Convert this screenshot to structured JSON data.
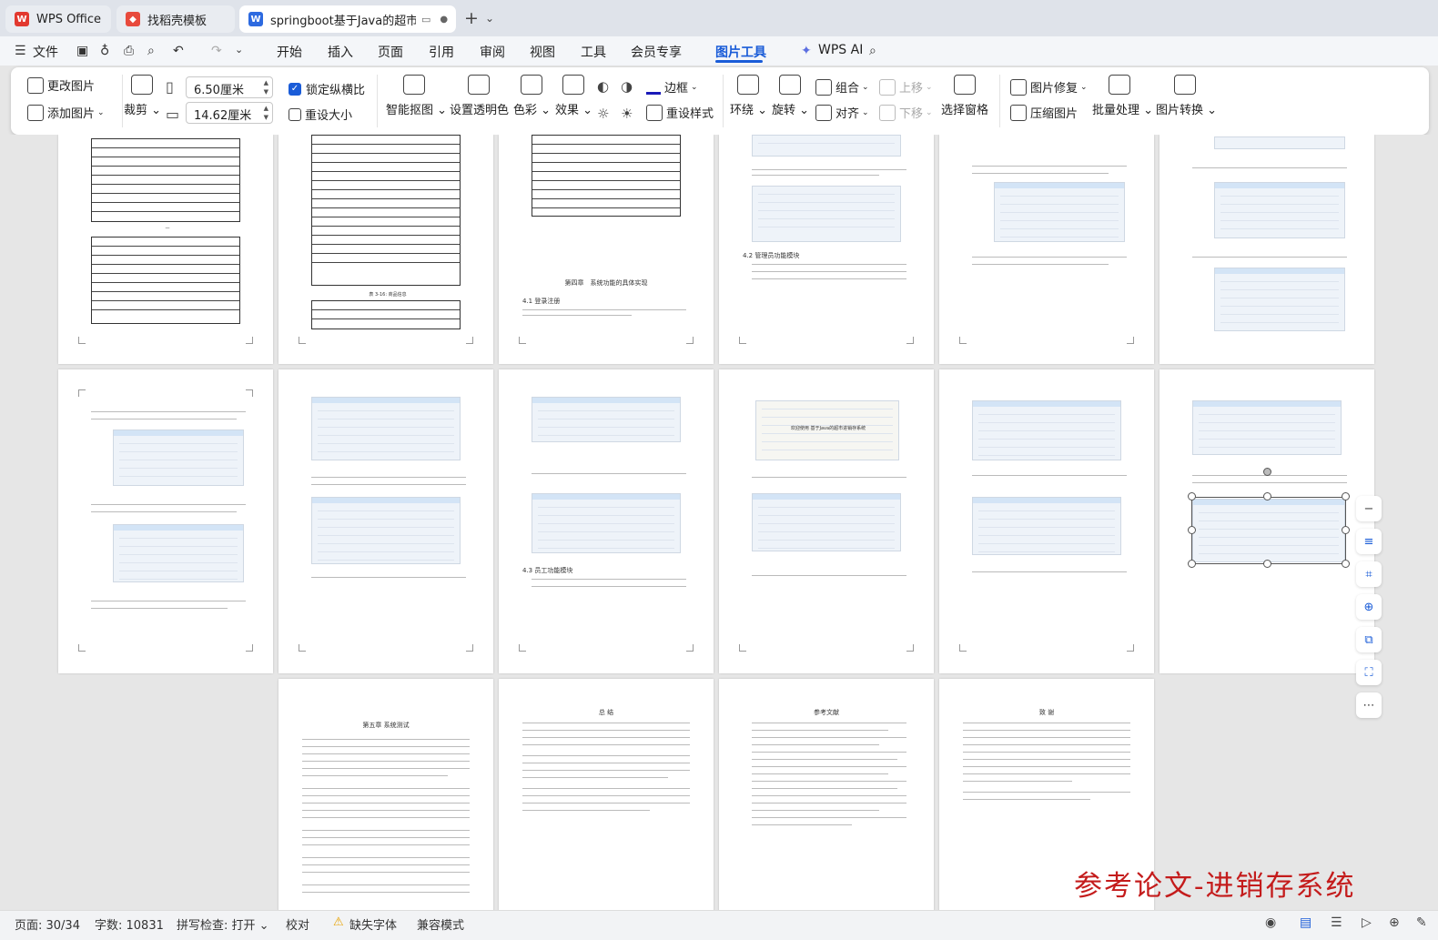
{
  "tabs": {
    "t1": "WPS Office",
    "t2": "找稻壳模板",
    "t3": "springboot基于Java的超市进"
  },
  "menu": {
    "file": "文件",
    "items": [
      "开始",
      "插入",
      "页面",
      "引用",
      "审阅",
      "视图",
      "工具",
      "会员专享",
      "图片工具"
    ],
    "ai": "WPS AI"
  },
  "ribbon": {
    "change_image": "更改图片",
    "add_image": "添加图片",
    "crop": "裁剪",
    "width_value": "6.50厘米",
    "height_value": "14.62厘米",
    "lock_ratio": "锁定纵横比",
    "reset_size": "重设大小",
    "smart_cutout": "智能抠图",
    "set_transparent": "设置透明色",
    "color": "色彩",
    "effect": "效果",
    "border": "边框",
    "reset_style": "重设样式",
    "wrap": "环绕",
    "rotate": "旋转",
    "group": "组合",
    "align": "对齐",
    "bring_forward": "上移",
    "send_backward": "下移",
    "selection_pane": "选择窗格",
    "image_repair": "图片修复",
    "compress": "压缩图片",
    "batch": "批量处理",
    "convert": "图片转换"
  },
  "pages": {
    "chapter4_title": "第四章　系统功能的具体实现",
    "chapter4_1": "4.1 登录注册",
    "chapter4_2": "4.2 管理员功能模块",
    "chapter4_3": "4.3 员工功能模块",
    "chapter5_title": "第五章 系统测试",
    "summary_title": "总 结",
    "refs_title": "参考文献",
    "thanks_title": "致 谢",
    "welcome_banner": "欢迎使用 基于Java的超市进销存系统",
    "table_caption": "表 3-16: 商品信息"
  },
  "watermark": "参考论文-进销存系统",
  "status": {
    "page": "页面: 30/34",
    "words": "字数: 10831",
    "spell": "拼写检查: 打开",
    "proof": "校对",
    "missing_font": "缺失字体",
    "compat": "兼容模式"
  }
}
